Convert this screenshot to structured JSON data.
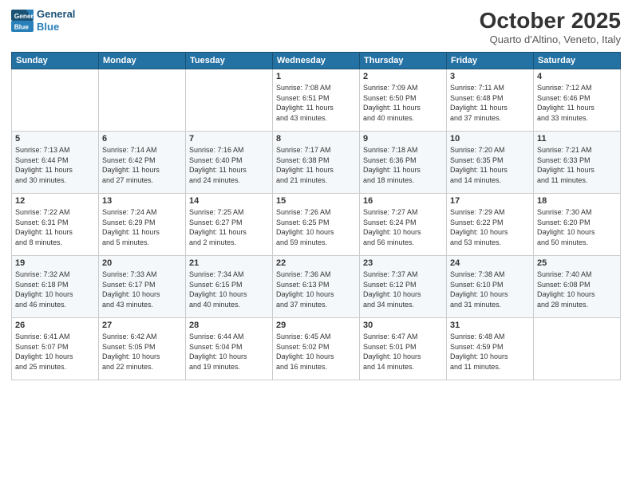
{
  "logo": {
    "line1": "General",
    "line2": "Blue"
  },
  "title": "October 2025",
  "subtitle": "Quarto d'Altino, Veneto, Italy",
  "days_header": [
    "Sunday",
    "Monday",
    "Tuesday",
    "Wednesday",
    "Thursday",
    "Friday",
    "Saturday"
  ],
  "weeks": [
    [
      {
        "day": "",
        "info": ""
      },
      {
        "day": "",
        "info": ""
      },
      {
        "day": "",
        "info": ""
      },
      {
        "day": "1",
        "info": "Sunrise: 7:08 AM\nSunset: 6:51 PM\nDaylight: 11 hours\nand 43 minutes."
      },
      {
        "day": "2",
        "info": "Sunrise: 7:09 AM\nSunset: 6:50 PM\nDaylight: 11 hours\nand 40 minutes."
      },
      {
        "day": "3",
        "info": "Sunrise: 7:11 AM\nSunset: 6:48 PM\nDaylight: 11 hours\nand 37 minutes."
      },
      {
        "day": "4",
        "info": "Sunrise: 7:12 AM\nSunset: 6:46 PM\nDaylight: 11 hours\nand 33 minutes."
      }
    ],
    [
      {
        "day": "5",
        "info": "Sunrise: 7:13 AM\nSunset: 6:44 PM\nDaylight: 11 hours\nand 30 minutes."
      },
      {
        "day": "6",
        "info": "Sunrise: 7:14 AM\nSunset: 6:42 PM\nDaylight: 11 hours\nand 27 minutes."
      },
      {
        "day": "7",
        "info": "Sunrise: 7:16 AM\nSunset: 6:40 PM\nDaylight: 11 hours\nand 24 minutes."
      },
      {
        "day": "8",
        "info": "Sunrise: 7:17 AM\nSunset: 6:38 PM\nDaylight: 11 hours\nand 21 minutes."
      },
      {
        "day": "9",
        "info": "Sunrise: 7:18 AM\nSunset: 6:36 PM\nDaylight: 11 hours\nand 18 minutes."
      },
      {
        "day": "10",
        "info": "Sunrise: 7:20 AM\nSunset: 6:35 PM\nDaylight: 11 hours\nand 14 minutes."
      },
      {
        "day": "11",
        "info": "Sunrise: 7:21 AM\nSunset: 6:33 PM\nDaylight: 11 hours\nand 11 minutes."
      }
    ],
    [
      {
        "day": "12",
        "info": "Sunrise: 7:22 AM\nSunset: 6:31 PM\nDaylight: 11 hours\nand 8 minutes."
      },
      {
        "day": "13",
        "info": "Sunrise: 7:24 AM\nSunset: 6:29 PM\nDaylight: 11 hours\nand 5 minutes."
      },
      {
        "day": "14",
        "info": "Sunrise: 7:25 AM\nSunset: 6:27 PM\nDaylight: 11 hours\nand 2 minutes."
      },
      {
        "day": "15",
        "info": "Sunrise: 7:26 AM\nSunset: 6:25 PM\nDaylight: 10 hours\nand 59 minutes."
      },
      {
        "day": "16",
        "info": "Sunrise: 7:27 AM\nSunset: 6:24 PM\nDaylight: 10 hours\nand 56 minutes."
      },
      {
        "day": "17",
        "info": "Sunrise: 7:29 AM\nSunset: 6:22 PM\nDaylight: 10 hours\nand 53 minutes."
      },
      {
        "day": "18",
        "info": "Sunrise: 7:30 AM\nSunset: 6:20 PM\nDaylight: 10 hours\nand 50 minutes."
      }
    ],
    [
      {
        "day": "19",
        "info": "Sunrise: 7:32 AM\nSunset: 6:18 PM\nDaylight: 10 hours\nand 46 minutes."
      },
      {
        "day": "20",
        "info": "Sunrise: 7:33 AM\nSunset: 6:17 PM\nDaylight: 10 hours\nand 43 minutes."
      },
      {
        "day": "21",
        "info": "Sunrise: 7:34 AM\nSunset: 6:15 PM\nDaylight: 10 hours\nand 40 minutes."
      },
      {
        "day": "22",
        "info": "Sunrise: 7:36 AM\nSunset: 6:13 PM\nDaylight: 10 hours\nand 37 minutes."
      },
      {
        "day": "23",
        "info": "Sunrise: 7:37 AM\nSunset: 6:12 PM\nDaylight: 10 hours\nand 34 minutes."
      },
      {
        "day": "24",
        "info": "Sunrise: 7:38 AM\nSunset: 6:10 PM\nDaylight: 10 hours\nand 31 minutes."
      },
      {
        "day": "25",
        "info": "Sunrise: 7:40 AM\nSunset: 6:08 PM\nDaylight: 10 hours\nand 28 minutes."
      }
    ],
    [
      {
        "day": "26",
        "info": "Sunrise: 6:41 AM\nSunset: 5:07 PM\nDaylight: 10 hours\nand 25 minutes."
      },
      {
        "day": "27",
        "info": "Sunrise: 6:42 AM\nSunset: 5:05 PM\nDaylight: 10 hours\nand 22 minutes."
      },
      {
        "day": "28",
        "info": "Sunrise: 6:44 AM\nSunset: 5:04 PM\nDaylight: 10 hours\nand 19 minutes."
      },
      {
        "day": "29",
        "info": "Sunrise: 6:45 AM\nSunset: 5:02 PM\nDaylight: 10 hours\nand 16 minutes."
      },
      {
        "day": "30",
        "info": "Sunrise: 6:47 AM\nSunset: 5:01 PM\nDaylight: 10 hours\nand 14 minutes."
      },
      {
        "day": "31",
        "info": "Sunrise: 6:48 AM\nSunset: 4:59 PM\nDaylight: 10 hours\nand 11 minutes."
      },
      {
        "day": "",
        "info": ""
      }
    ]
  ]
}
